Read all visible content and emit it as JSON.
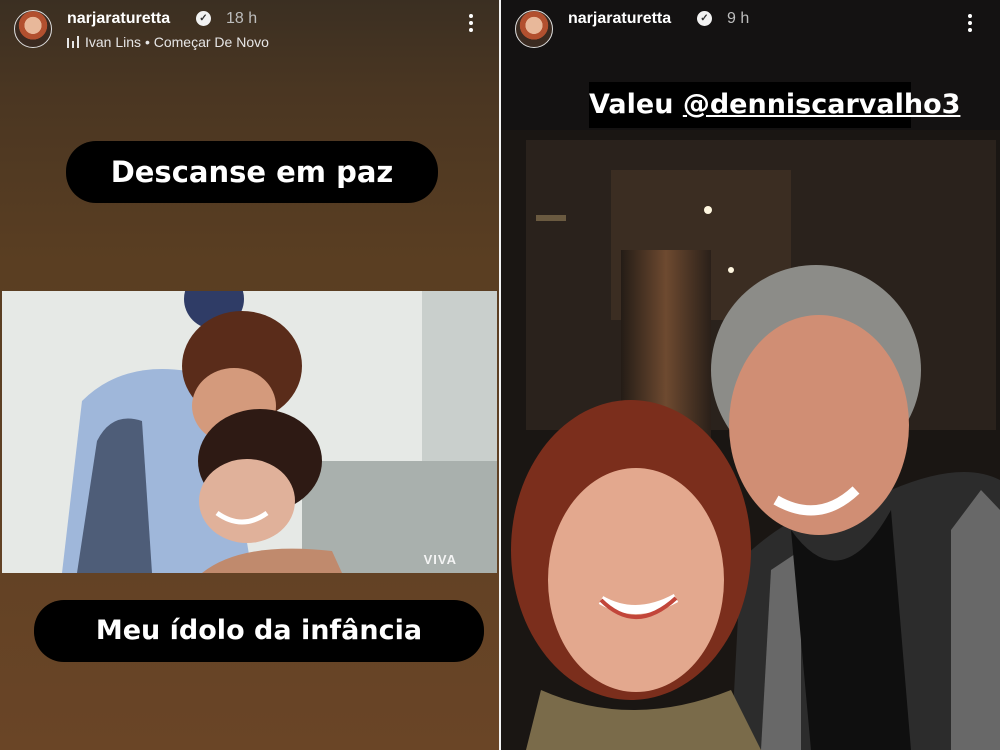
{
  "left_story": {
    "username": "narjaraturetta",
    "time": "18 h",
    "music": {
      "artist": "Ivan Lins",
      "separator": "•",
      "song": "Começar De Novo"
    },
    "text_top": "Descanse em paz",
    "text_bottom": "Meu ídolo da infância",
    "image_watermark": "VIVA"
  },
  "right_story": {
    "username": "narjaraturetta",
    "time": "9 h",
    "tag_prefix": "Valeu ",
    "tag_mention": "@denniscarvalho3"
  },
  "icons": {
    "verified": "verified-badge-icon",
    "more": "more-options-icon",
    "music": "music-bars-icon"
  },
  "colors": {
    "left_bg": "#5a3e22",
    "pill": "#000000",
    "text": "#ffffff"
  }
}
